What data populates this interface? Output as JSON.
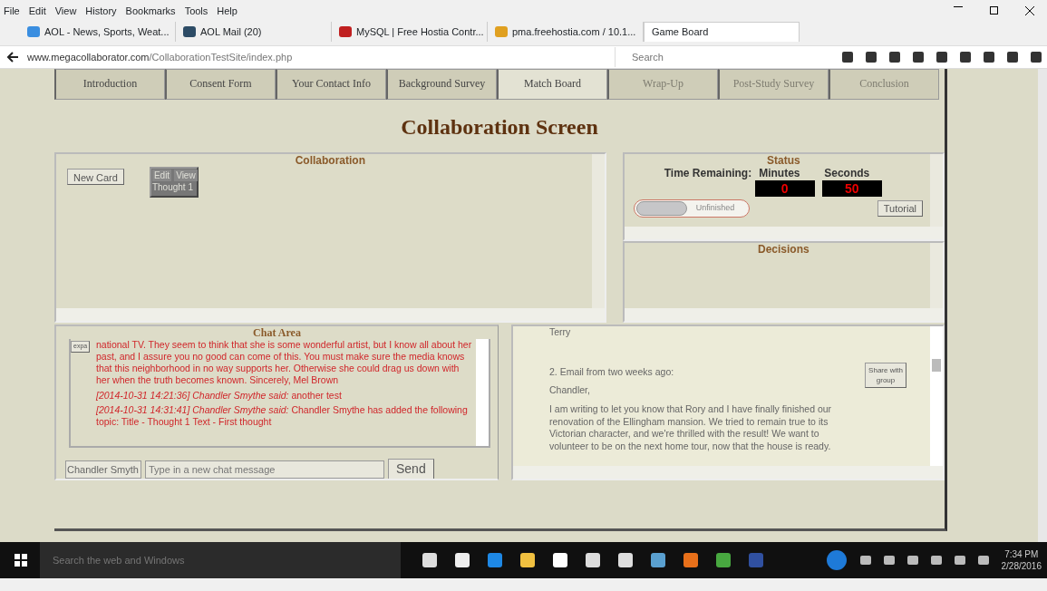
{
  "menu": [
    "File",
    "Edit",
    "View",
    "History",
    "Bookmarks",
    "Tools",
    "Help"
  ],
  "browser_tabs": [
    {
      "title": "AOL - News, Sports, Weat...",
      "kind": "aol",
      "selected": false
    },
    {
      "title": "AOL Mail (20)",
      "kind": "mail",
      "selected": false
    },
    {
      "title": "MySQL | Free Hostia Contr...",
      "kind": "hostia",
      "selected": false
    },
    {
      "title": "pma.freehostia.com / 10.1...",
      "kind": "pma",
      "selected": false
    },
    {
      "title": "Game Board",
      "kind": "plain",
      "selected": true
    }
  ],
  "address": {
    "host": "www.megacollaborator.com",
    "path": "/CollaborationTestSite/index.php"
  },
  "search": {
    "placeholder": "Search"
  },
  "page_tabs": [
    {
      "label": "Introduction",
      "selected": false,
      "disabled": false
    },
    {
      "label": "Consent Form",
      "selected": false,
      "disabled": false
    },
    {
      "label": "Your Contact Info",
      "selected": false,
      "disabled": false
    },
    {
      "label": "Background Survey",
      "selected": false,
      "disabled": false
    },
    {
      "label": "Match Board",
      "selected": true,
      "disabled": false
    },
    {
      "label": "Wrap-Up",
      "selected": false,
      "disabled": true
    },
    {
      "label": "Post-Study Survey",
      "selected": false,
      "disabled": true
    },
    {
      "label": "Conclusion",
      "selected": false,
      "disabled": true
    }
  ],
  "heading": "Collaboration Screen",
  "collaboration": {
    "title": "Collaboration",
    "new_card": "New Card",
    "card": {
      "edit": "Edit",
      "view": "View",
      "title": "Thought 1"
    }
  },
  "status": {
    "title": "Status",
    "time_label": "Time Remaining:",
    "minutes_label": "Minutes",
    "seconds_label": "Seconds",
    "minutes": "0",
    "seconds": "50",
    "toggle_label": "Unfinished",
    "tutorial": "Tutorial"
  },
  "decisions": {
    "title": "Decisions"
  },
  "chat": {
    "title": "Chat Area",
    "expand_button": "expa",
    "messages": [
      "national TV. They seem to think that she is some wonderful artist, but I know all about her past, and I assure you no good can come of this. You must make sure the media knows that this neighborhood in no way supports her. Otherwise she could drag us down with her when the truth becomes known. Sincerely, Mel Brown",
      "*[2014-10-31 14:21:36] Chandler Smythe said:* another test",
      "*[2014-10-31 14:31:41] Chandler Smythe said:* Chandler Smythe has added the following topic: Title - Thought 1 Text - First thought"
    ],
    "name_value": "Chandler Smyth",
    "message_placeholder": "Type in a new chat message",
    "send": "Send"
  },
  "document": {
    "paragraphs": [
      "Terry",
      "2. Email from two weeks ago:",
      "Chandler,",
      "I am writing to let you know that Rory and I have finally finished our renovation of the Ellingham mansion. We tried to remain true to its Victorian character, and we're thrilled with the result! We want to volunteer to be on the next home tour, now that the house is ready."
    ],
    "share_button": "Share with group"
  },
  "taskbar": {
    "search_placeholder": "Search the web and Windows",
    "time": "7:34 PM",
    "date": "2/28/2016"
  }
}
